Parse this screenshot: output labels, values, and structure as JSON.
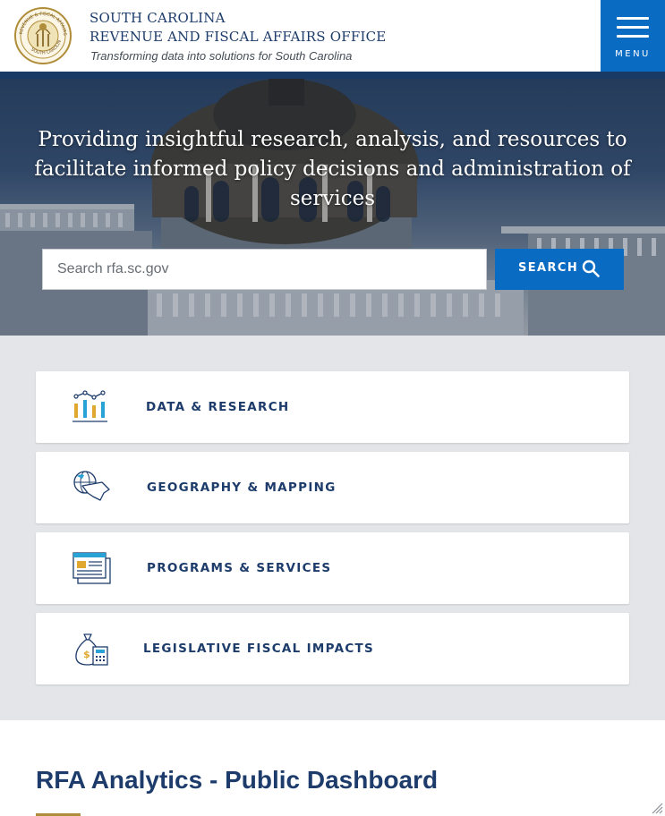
{
  "header": {
    "org_line1": "SOUTH CAROLINA",
    "org_line2": "REVENUE AND FISCAL AFFAIRS OFFICE",
    "tagline": "Transforming data into solutions for South Carolina",
    "menu_label": "MENU",
    "seal_top_text": "REVENUE & FISCAL AFFAIRS OFFICE",
    "seal_bottom_text": "SOUTH CAROLINA"
  },
  "hero": {
    "heading": "Providing insightful research, analysis, and resources to facilitate informed policy decisions and administration of services",
    "search_placeholder": "Search rfa.sc.gov",
    "search_value": "",
    "search_button_label": "SEARCH"
  },
  "cards": [
    {
      "label": "DATA & RESEARCH",
      "icon": "chart-icon"
    },
    {
      "label": "GEOGRAPHY & MAPPING",
      "icon": "globe-map-icon"
    },
    {
      "label": "PROGRAMS & SERVICES",
      "icon": "documents-icon"
    },
    {
      "label": "LEGISLATIVE FISCAL IMPACTS",
      "icon": "money-bag-calculator-icon"
    }
  ],
  "dashboard": {
    "title": "RFA Analytics - Public Dashboard"
  },
  "colors": {
    "brand_navy": "#1d3c6b",
    "accent_blue": "#0a6bc2",
    "accent_gold": "#b08d3a",
    "section_gray": "#e3e5e8"
  }
}
